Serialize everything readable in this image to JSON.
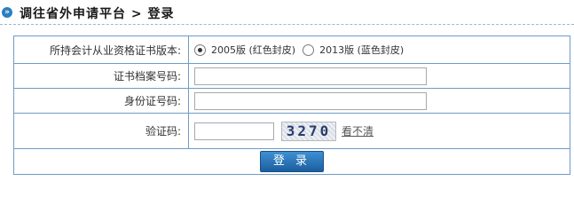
{
  "header": {
    "title": "调往省外申请平台 > 登录"
  },
  "form": {
    "version_label": "所持会计从业资格证书版本:",
    "version_options": [
      {
        "label": "2005版 (红色封皮)",
        "checked": true
      },
      {
        "label": "2013版 (蓝色封皮)",
        "checked": false
      }
    ],
    "cert_label": "证书档案号码:",
    "cert_value": "",
    "id_label": "身份证号码:",
    "id_value": "",
    "captcha_label": "验证码:",
    "captcha_value": "",
    "captcha_text": "3270",
    "captcha_refresh": "看不清",
    "submit_label": "登 录"
  }
}
